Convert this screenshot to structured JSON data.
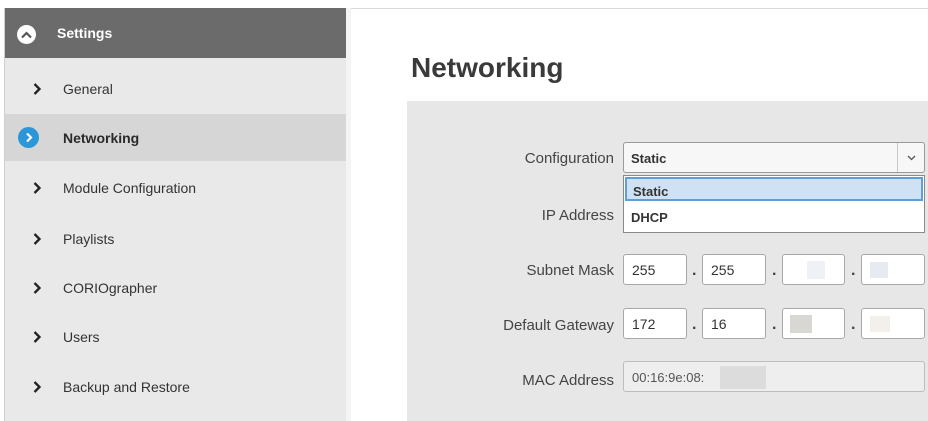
{
  "sidebar": {
    "header": {
      "title": "Settings",
      "icon": "chevron-up-circle-icon"
    },
    "items": [
      {
        "label": "General",
        "active": false
      },
      {
        "label": "Networking",
        "active": true
      },
      {
        "label": "Module Configuration",
        "active": false
      },
      {
        "label": "Playlists",
        "active": false
      },
      {
        "label": "CORIOgrapher",
        "active": false
      },
      {
        "label": "Users",
        "active": false
      },
      {
        "label": "Backup and Restore",
        "active": false
      }
    ]
  },
  "main": {
    "title": "Networking",
    "form": {
      "configuration": {
        "label": "Configuration",
        "value": "Static",
        "options": [
          "Static",
          "DHCP"
        ]
      },
      "ip_address": {
        "label": "IP Address"
      },
      "subnet_mask": {
        "label": "Subnet Mask",
        "octets": [
          "255",
          "255",
          "",
          ""
        ]
      },
      "default_gateway": {
        "label": "Default Gateway",
        "octets": [
          "172",
          "16",
          "",
          ""
        ]
      },
      "mac_address": {
        "label": "MAC Address",
        "value": "00:16:9e:08:"
      },
      "separator": "."
    }
  },
  "colors": {
    "accent": "#2b97d8",
    "header_bg": "#6b6b6b",
    "sidebar_bg": "#e9e9e9",
    "panel_bg": "#e7e7e7"
  }
}
